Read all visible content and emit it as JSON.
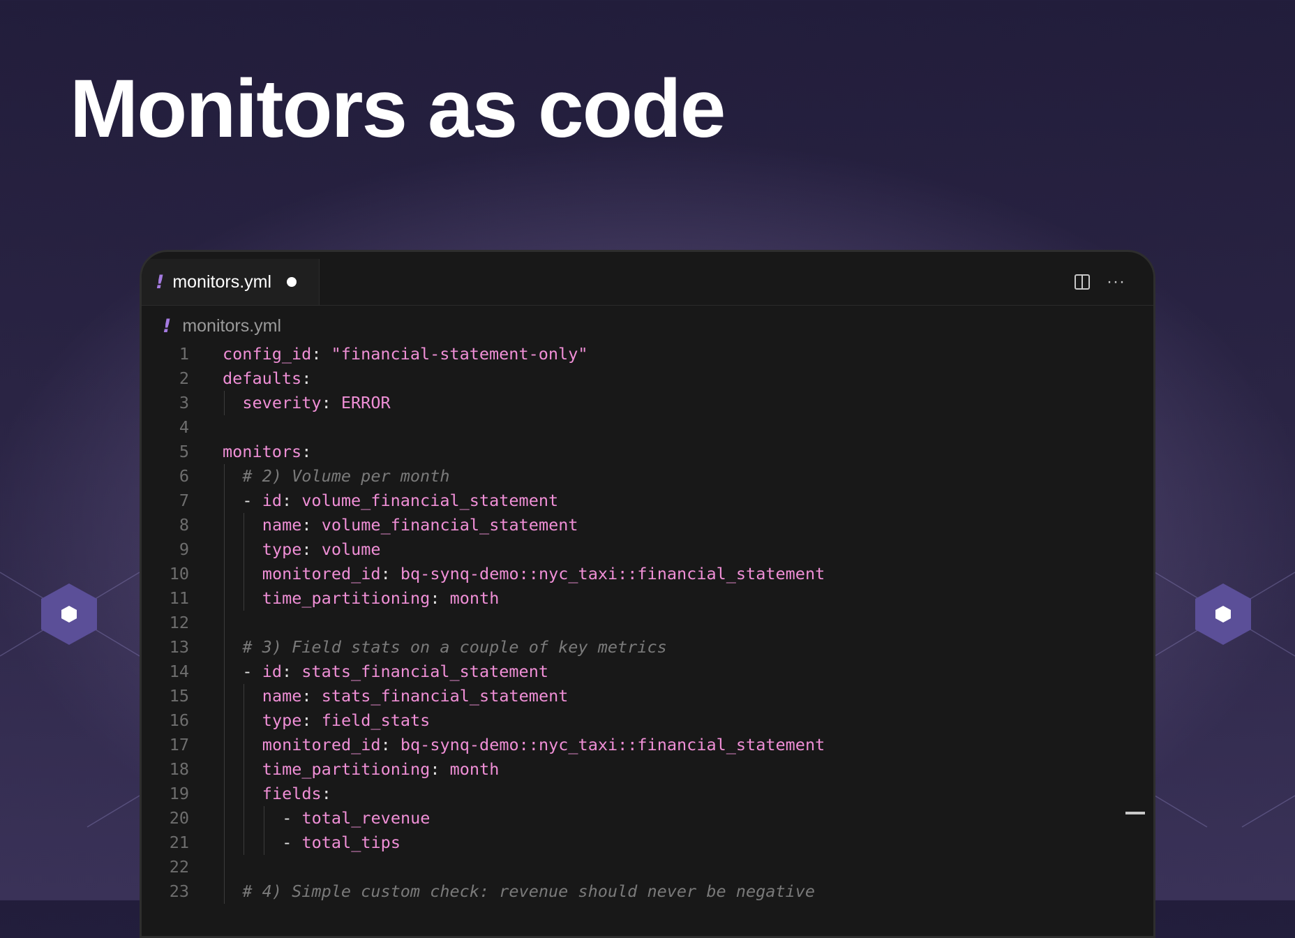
{
  "page": {
    "title": "Monitors as code"
  },
  "editor": {
    "tab": {
      "filename": "monitors.yml",
      "file_icon": "exclamation-yaml-icon",
      "modified": true
    },
    "breadcrumb": {
      "filename": "monitors.yml"
    },
    "actions": {
      "split_icon": "split-editor-icon",
      "more_icon": "more-actions-icon",
      "more_glyph": "···"
    }
  },
  "code_lines": [
    {
      "n": "1",
      "indent": 0,
      "tokens": [
        {
          "t": "k",
          "v": "config_id"
        },
        {
          "t": "p",
          "v": ": "
        },
        {
          "t": "s",
          "v": "\"financial-statement-only\""
        }
      ]
    },
    {
      "n": "2",
      "indent": 0,
      "tokens": [
        {
          "t": "k",
          "v": "defaults"
        },
        {
          "t": "p",
          "v": ":"
        }
      ]
    },
    {
      "n": "3",
      "indent": 1,
      "tokens": [
        {
          "t": "k",
          "v": "severity"
        },
        {
          "t": "p",
          "v": ": "
        },
        {
          "t": "v",
          "v": "ERROR"
        }
      ]
    },
    {
      "n": "4",
      "indent": 0,
      "tokens": []
    },
    {
      "n": "5",
      "indent": 0,
      "tokens": [
        {
          "t": "k",
          "v": "monitors"
        },
        {
          "t": "p",
          "v": ":"
        }
      ]
    },
    {
      "n": "6",
      "indent": 1,
      "tokens": [
        {
          "t": "c",
          "v": "# 2) Volume per month"
        }
      ]
    },
    {
      "n": "7",
      "indent": 1,
      "tokens": [
        {
          "t": "p",
          "v": "- "
        },
        {
          "t": "k",
          "v": "id"
        },
        {
          "t": "p",
          "v": ": "
        },
        {
          "t": "v",
          "v": "volume_financial_statement"
        }
      ]
    },
    {
      "n": "8",
      "indent": 2,
      "tokens": [
        {
          "t": "k",
          "v": "name"
        },
        {
          "t": "p",
          "v": ": "
        },
        {
          "t": "v",
          "v": "volume_financial_statement"
        }
      ]
    },
    {
      "n": "9",
      "indent": 2,
      "tokens": [
        {
          "t": "k",
          "v": "type"
        },
        {
          "t": "p",
          "v": ": "
        },
        {
          "t": "v",
          "v": "volume"
        }
      ]
    },
    {
      "n": "10",
      "indent": 2,
      "tokens": [
        {
          "t": "k",
          "v": "monitored_id"
        },
        {
          "t": "p",
          "v": ": "
        },
        {
          "t": "v",
          "v": "bq-synq-demo::nyc_taxi::financial_statement"
        }
      ]
    },
    {
      "n": "11",
      "indent": 2,
      "tokens": [
        {
          "t": "k",
          "v": "time_partitioning"
        },
        {
          "t": "p",
          "v": ": "
        },
        {
          "t": "v",
          "v": "month"
        }
      ]
    },
    {
      "n": "12",
      "indent": 1,
      "tokens": []
    },
    {
      "n": "13",
      "indent": 1,
      "tokens": [
        {
          "t": "c",
          "v": "# 3) Field stats on a couple of key metrics"
        }
      ]
    },
    {
      "n": "14",
      "indent": 1,
      "tokens": [
        {
          "t": "p",
          "v": "- "
        },
        {
          "t": "k",
          "v": "id"
        },
        {
          "t": "p",
          "v": ": "
        },
        {
          "t": "v",
          "v": "stats_financial_statement"
        }
      ]
    },
    {
      "n": "15",
      "indent": 2,
      "tokens": [
        {
          "t": "k",
          "v": "name"
        },
        {
          "t": "p",
          "v": ": "
        },
        {
          "t": "v",
          "v": "stats_financial_statement"
        }
      ]
    },
    {
      "n": "16",
      "indent": 2,
      "tokens": [
        {
          "t": "k",
          "v": "type"
        },
        {
          "t": "p",
          "v": ": "
        },
        {
          "t": "v",
          "v": "field_stats"
        }
      ]
    },
    {
      "n": "17",
      "indent": 2,
      "tokens": [
        {
          "t": "k",
          "v": "monitored_id"
        },
        {
          "t": "p",
          "v": ": "
        },
        {
          "t": "v",
          "v": "bq-synq-demo::nyc_taxi::financial_statement"
        }
      ]
    },
    {
      "n": "18",
      "indent": 2,
      "tokens": [
        {
          "t": "k",
          "v": "time_partitioning"
        },
        {
          "t": "p",
          "v": ": "
        },
        {
          "t": "v",
          "v": "month"
        }
      ]
    },
    {
      "n": "19",
      "indent": 2,
      "tokens": [
        {
          "t": "k",
          "v": "fields"
        },
        {
          "t": "p",
          "v": ":"
        }
      ]
    },
    {
      "n": "20",
      "indent": 3,
      "tokens": [
        {
          "t": "p",
          "v": "- "
        },
        {
          "t": "v",
          "v": "total_revenue"
        }
      ]
    },
    {
      "n": "21",
      "indent": 3,
      "tokens": [
        {
          "t": "p",
          "v": "- "
        },
        {
          "t": "v",
          "v": "total_tips"
        }
      ]
    },
    {
      "n": "22",
      "indent": 1,
      "tokens": []
    },
    {
      "n": "23",
      "indent": 1,
      "tokens": [
        {
          "t": "c",
          "v": "# 4) Simple custom check: revenue should never be negative"
        }
      ]
    }
  ],
  "colors": {
    "keys": "#ef8fd6",
    "comment": "#7a7a7a",
    "punct": "#e2e2e2",
    "line_number": "#6e6e6e",
    "yaml_icon": "#a57be0",
    "background": "#181818"
  },
  "decorations": {
    "left_icon": "hexagon-icon",
    "right_icon": "hexagon-icon"
  }
}
